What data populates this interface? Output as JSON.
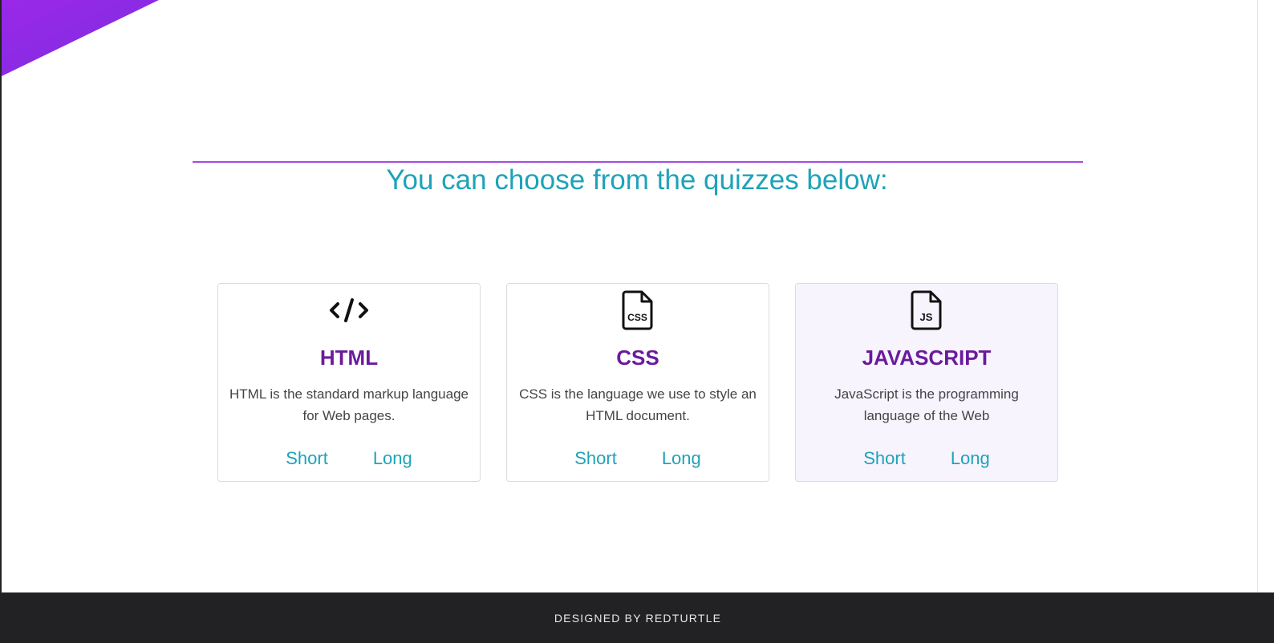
{
  "heading": "You can choose from the quizzes below:",
  "quizzes": [
    {
      "icon": "code-icon",
      "title": "HTML",
      "description": "HTML is the standard markup language for Web pages.",
      "short_label": "Short",
      "long_label": "Long"
    },
    {
      "icon": "css-file-icon",
      "title": "CSS",
      "description": "CSS is the language we use to style an HTML document.",
      "short_label": "Short",
      "long_label": "Long"
    },
    {
      "icon": "js-file-icon",
      "title": "JAVASCRIPT",
      "description": "JavaScript is the programming language of the Web",
      "short_label": "Short",
      "long_label": "Long"
    }
  ],
  "footer": {
    "text": "DESIGNED BY REDTURTLE"
  },
  "icon_labels": {
    "css": "CSS",
    "js": "JS"
  },
  "colors": {
    "accent": "#1ea3b8",
    "title": "#6a1b9a",
    "divider": "#a64be0",
    "corner_gradient_start": "#9b27e8",
    "corner_gradient_end": "#7b2fe0",
    "footer_bg": "#222123"
  }
}
